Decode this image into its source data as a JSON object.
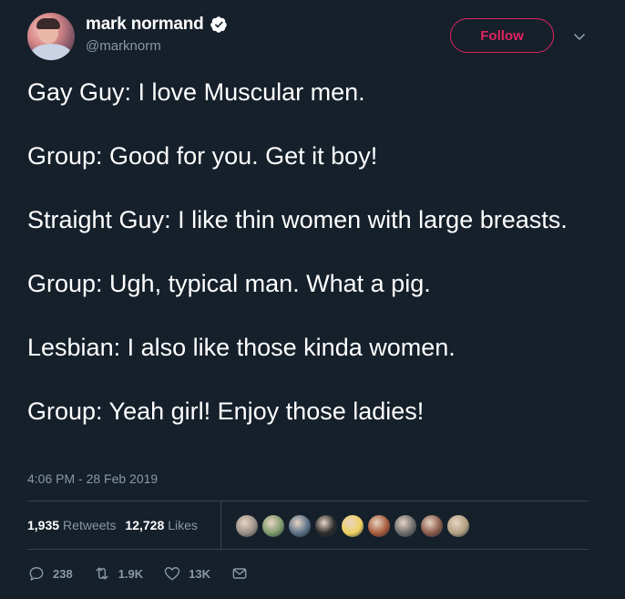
{
  "author": {
    "display_name": "mark normand",
    "handle": "@marknorm",
    "verified": true
  },
  "follow_label": "Follow",
  "tweet_lines": [
    "Gay Guy: I love Muscular men.",
    "Group: Good for you. Get it boy!",
    "Straight Guy: I like thin women with large breasts.",
    "Group: Ugh, typical man. What a pig.",
    "Lesbian: I also like those kinda women.",
    "Group: Yeah girl! Enjoy those ladies!"
  ],
  "timestamp": "4:06 PM - 28 Feb 2019",
  "stats": {
    "retweets_count": "1,935",
    "retweets_label": "Retweets",
    "likes_count": "12,728",
    "likes_label": "Likes"
  },
  "likers_colors": [
    "#9a8f86",
    "#7d9a6a",
    "#5a7086",
    "#2a2a2a",
    "#f0d060",
    "#a85a3a",
    "#6a6a6a",
    "#8a5a4a",
    "#b0a080"
  ],
  "actions": {
    "replies": "238",
    "retweets": "1.9K",
    "likes": "13K"
  },
  "colors": {
    "background": "#15202b",
    "accent": "#e0245e",
    "secondary_text": "#8899a6",
    "verified_blue": "#1da1f2"
  }
}
